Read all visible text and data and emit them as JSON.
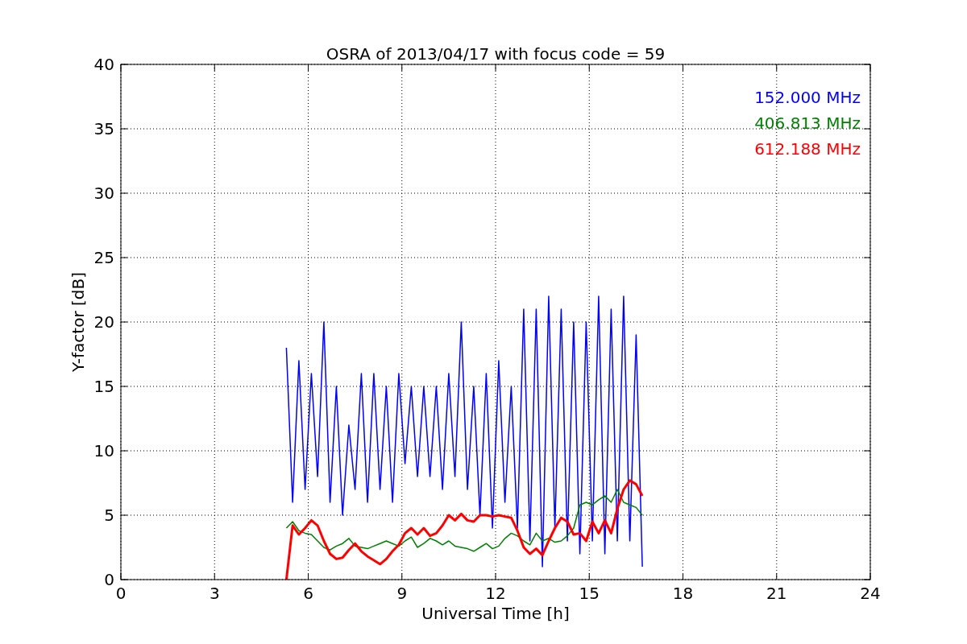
{
  "figure": {
    "chart_data": {
      "type": "line",
      "title": "OSRA of 2013/04/17 with focus code = 59",
      "xlabel": "Universal Time [h]",
      "ylabel": "Y-factor [dB]",
      "xlim": [
        0,
        24
      ],
      "ylim": [
        0,
        40
      ],
      "xticks": [
        0,
        3,
        6,
        9,
        12,
        15,
        18,
        21,
        24
      ],
      "yticks": [
        0,
        5,
        10,
        15,
        20,
        25,
        30,
        35,
        40
      ],
      "grid": true,
      "x": [
        5.3,
        5.5,
        5.7,
        5.9,
        6.1,
        6.3,
        6.5,
        6.7,
        6.9,
        7.1,
        7.3,
        7.5,
        7.7,
        7.9,
        8.1,
        8.3,
        8.5,
        8.7,
        8.9,
        9.1,
        9.3,
        9.5,
        9.7,
        9.9,
        10.1,
        10.3,
        10.5,
        10.7,
        10.9,
        11.1,
        11.3,
        11.5,
        11.7,
        11.9,
        12.1,
        12.3,
        12.5,
        12.7,
        12.9,
        13.1,
        13.3,
        13.5,
        13.7,
        13.9,
        14.1,
        14.3,
        14.5,
        14.7,
        14.9,
        15.1,
        15.3,
        15.5,
        15.7,
        15.9,
        16.1,
        16.3,
        16.5,
        16.7
      ],
      "series": [
        {
          "name": "152.000 MHz",
          "color": "#0000ff",
          "values": [
            18,
            6,
            17,
            7,
            16,
            8,
            20,
            6,
            15,
            5,
            12,
            7,
            16,
            6,
            16,
            7,
            15,
            6,
            16,
            9,
            15,
            8,
            15,
            8,
            15,
            7,
            16,
            8,
            20,
            7,
            15,
            5,
            16,
            4,
            17,
            6,
            15,
            4,
            21,
            3,
            21,
            1,
            22,
            4,
            21,
            3,
            20,
            2,
            20,
            3,
            22,
            2,
            21,
            3,
            22,
            3,
            19,
            1
          ]
        },
        {
          "name": "406.813 MHz",
          "color": "#008000",
          "values": [
            4,
            4.5,
            3.8,
            3.6,
            3.5,
            3,
            2.5,
            2.3,
            2.6,
            2.8,
            3.2,
            2.6,
            2.5,
            2.4,
            2.6,
            2.8,
            3,
            2.8,
            2.6,
            3,
            3.3,
            2.5,
            2.8,
            3.2,
            3,
            2.7,
            3,
            2.6,
            2.5,
            2.4,
            2.2,
            2.5,
            2.8,
            2.4,
            2.6,
            3.2,
            3.6,
            3.4,
            3,
            2.7,
            3.6,
            3,
            3.2,
            2.9,
            3,
            3.4,
            4,
            5.8,
            6,
            5.8,
            6.2,
            6.5,
            6,
            7,
            6,
            5.8,
            5.6,
            5
          ]
        },
        {
          "name": "612.188 MHz",
          "color": "#ff0000",
          "values": [
            0,
            4.2,
            3.5,
            4,
            4.6,
            4.2,
            3,
            2,
            1.6,
            1.7,
            2.3,
            2.8,
            2.2,
            1.8,
            1.5,
            1.2,
            1.6,
            2.2,
            2.7,
            3.6,
            4,
            3.5,
            4,
            3.4,
            3.6,
            4.2,
            5,
            4.6,
            5.1,
            4.6,
            4.5,
            5,
            5,
            4.9,
            5,
            4.9,
            4.8,
            3.8,
            2.5,
            2,
            2.4,
            1.9,
            3,
            4,
            4.8,
            4.5,
            3.5,
            3.6,
            3,
            4.5,
            3.6,
            4.6,
            3.6,
            5.5,
            7,
            7.7,
            7.4,
            6.5
          ]
        }
      ]
    }
  }
}
